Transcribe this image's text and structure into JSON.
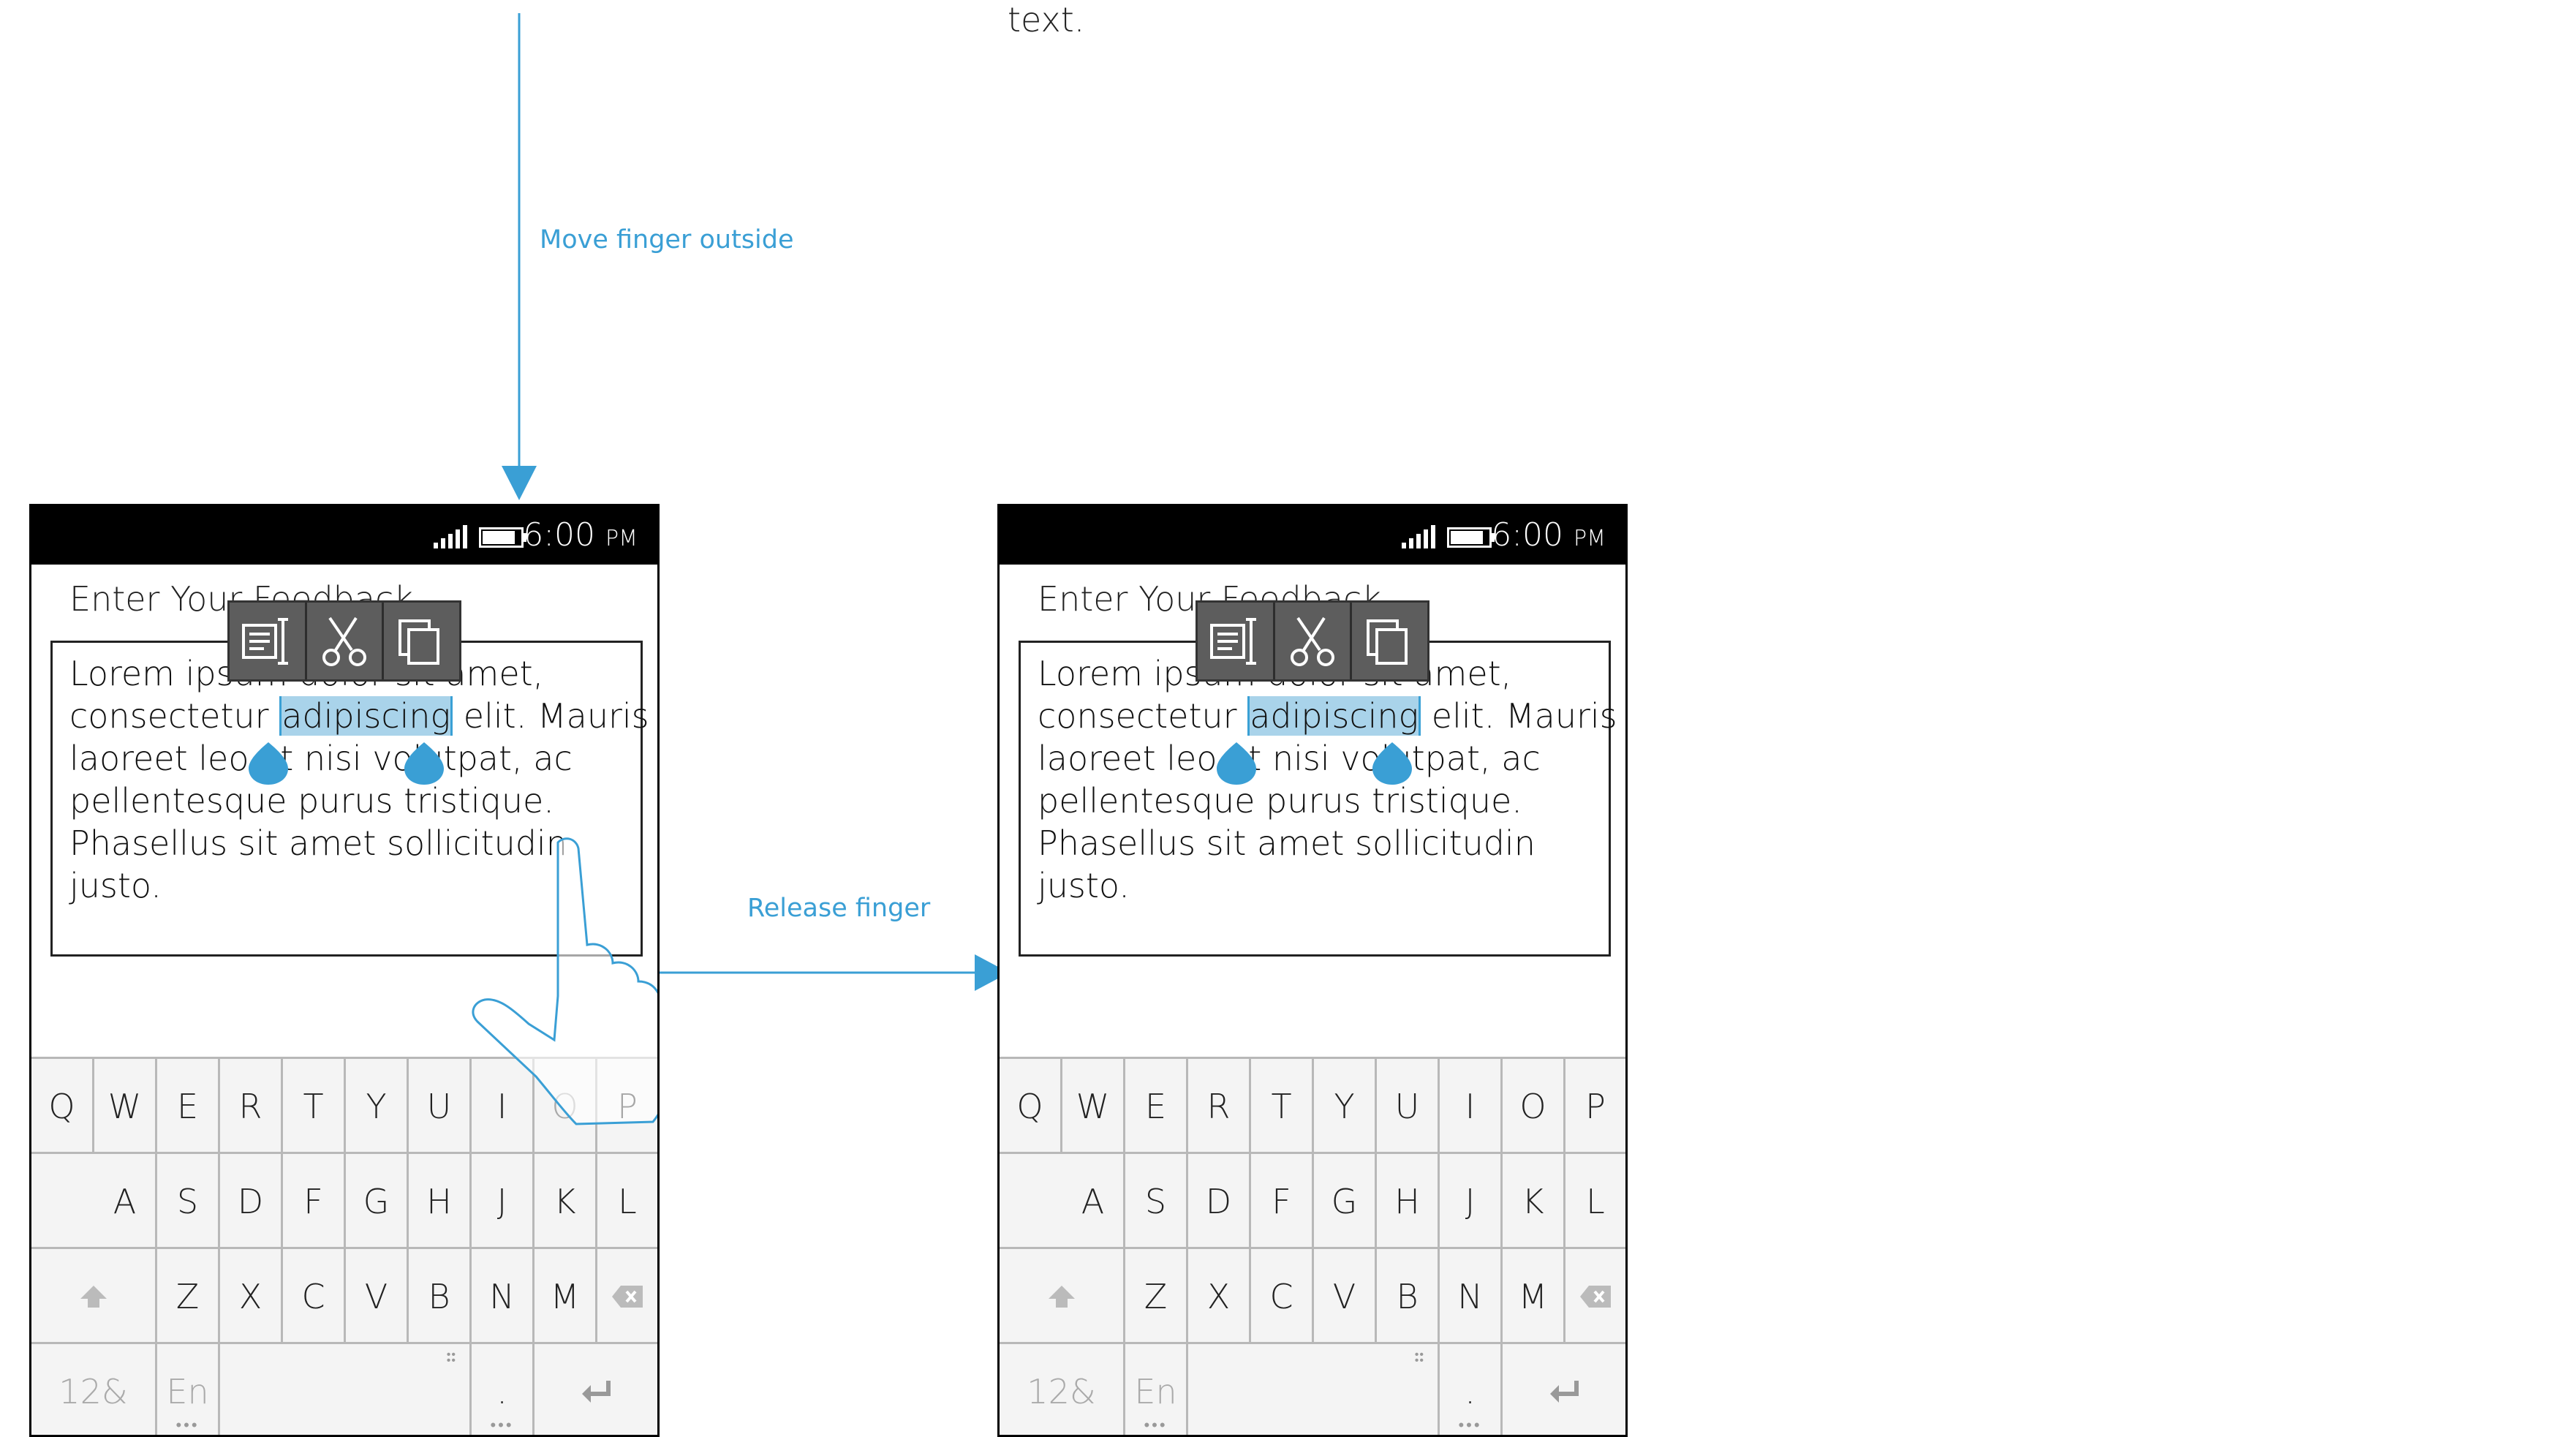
{
  "annotations": {
    "top_text": "text.",
    "move_finger": "Move finger outside",
    "release_finger": "Release finger"
  },
  "colors": {
    "accent": "#3a9fd5",
    "selection": "#a9d3ea",
    "toolbar": "#5d5d5d"
  },
  "phone": {
    "status_time": "6:00",
    "status_ampm": "PM",
    "title": "Enter Your Feedback",
    "lines": [
      "Lorem ipsum dolor sit amet,",
      "consectetur",
      "adipiscing",
      "elit. Mauris",
      "laoreet leo at nisi volutpat, ac",
      "pellentesque purus tristique.",
      "Phasellus sit amet sollicitudin",
      "justo."
    ],
    "toolbar_icons": [
      "select-all-icon",
      "cut-icon",
      "copy-icon"
    ]
  },
  "keyboard": {
    "row1": [
      "Q",
      "W",
      "E",
      "R",
      "T",
      "Y",
      "U",
      "I",
      "O",
      "P"
    ],
    "row2": [
      "A",
      "S",
      "D",
      "F",
      "G",
      "H",
      "J",
      "K",
      "L"
    ],
    "row3": [
      "Z",
      "X",
      "C",
      "V",
      "B",
      "N",
      "M"
    ],
    "symbols": "12&",
    "lang": "En",
    "period": "."
  }
}
